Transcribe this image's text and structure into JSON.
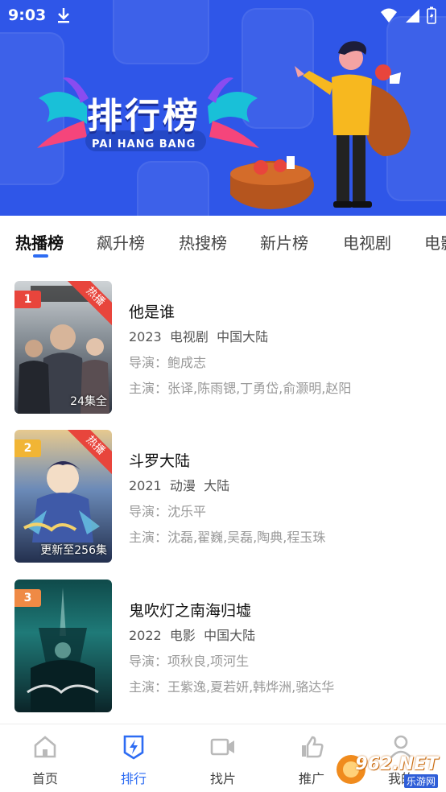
{
  "status": {
    "time": "9:03"
  },
  "banner": {
    "title": "排行榜",
    "subtitle": "PAI HANG BANG"
  },
  "tabs": [
    {
      "label": "热播榜",
      "active": true
    },
    {
      "label": "飙升榜"
    },
    {
      "label": "热搜榜"
    },
    {
      "label": "新片榜"
    },
    {
      "label": "电视剧"
    },
    {
      "label": "电影"
    }
  ],
  "list": [
    {
      "rank": "1",
      "ribbon": "热播",
      "caption": "24集全",
      "title": "他是谁",
      "year": "2023",
      "type": "电视剧",
      "region": "中国大陆",
      "director": "导演：鲍成志",
      "cast": "主演：张译,陈雨锶,丁勇岱,俞灏明,赵阳"
    },
    {
      "rank": "2",
      "ribbon": "热播",
      "caption": "更新至256集",
      "title": "斗罗大陆",
      "year": "2021",
      "type": "动漫",
      "region": "大陆",
      "director": "导演：沈乐平",
      "cast": "主演：沈磊,翟巍,吴磊,陶典,程玉珠"
    },
    {
      "rank": "3",
      "title": "鬼吹灯之南海归墟",
      "year": "2022",
      "type": "电影",
      "region": "中国大陆",
      "director": "导演：项秋良,项河生",
      "cast": "主演：王紫逸,夏若妍,韩烨洲,骆达华"
    }
  ],
  "nav": [
    {
      "label": "首页",
      "icon": "home-icon"
    },
    {
      "label": "排行",
      "icon": "rank-icon",
      "active": true
    },
    {
      "label": "找片",
      "icon": "video-camera-icon"
    },
    {
      "label": "推广",
      "icon": "thumbs-up-icon"
    },
    {
      "label": "我的",
      "icon": "user-icon"
    }
  ],
  "watermark": {
    "text": "962.NET",
    "sub": "乐游网"
  },
  "colors": {
    "banner": "#2f56e8",
    "accent": "#2d6cf3",
    "rank1": "#e8453c",
    "rank2": "#f1b535",
    "rank3": "#ef8a45"
  }
}
